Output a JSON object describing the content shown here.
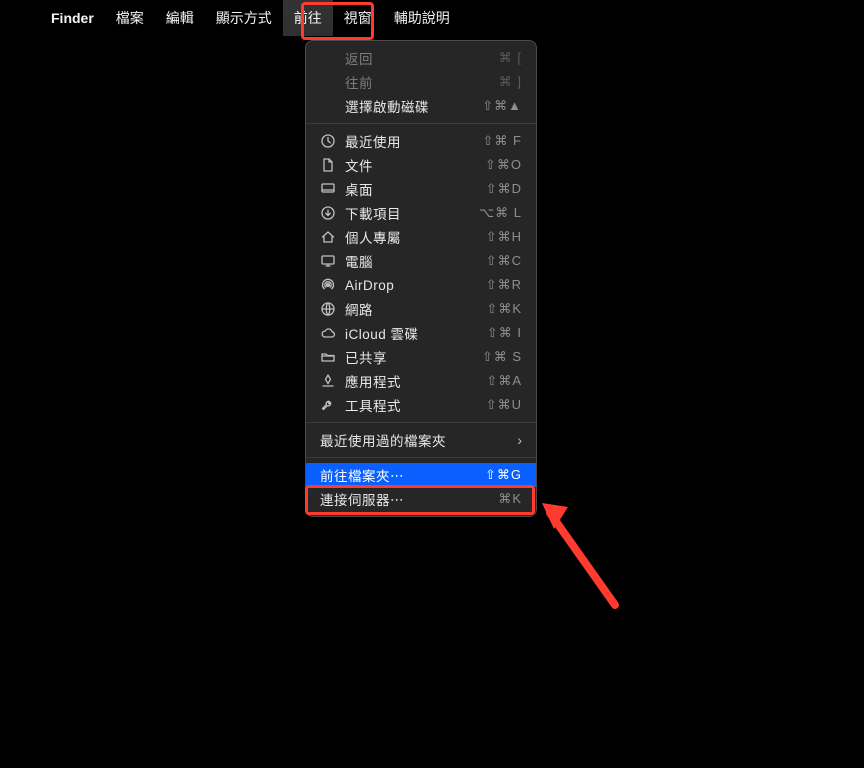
{
  "menubar": {
    "app": "Finder",
    "items": [
      "檔案",
      "編輯",
      "顯示方式",
      "前往",
      "視窗",
      "輔助說明"
    ],
    "open_index": 3
  },
  "dropdown": {
    "groups": [
      [
        {
          "id": "back",
          "label": "返回",
          "shortcut": "⌘ [",
          "disabled": true
        },
        {
          "id": "forward",
          "label": "往前",
          "shortcut": "⌘ ]",
          "disabled": true
        },
        {
          "id": "startup",
          "label": "選擇啟動磁碟",
          "shortcut": "⇧⌘▲"
        }
      ],
      [
        {
          "id": "recents",
          "icon": "clock-icon",
          "label": "最近使用",
          "shortcut": "⇧⌘ F"
        },
        {
          "id": "documents",
          "icon": "document-icon",
          "label": "文件",
          "shortcut": "⇧⌘O"
        },
        {
          "id": "desktop",
          "icon": "desktop-icon",
          "label": "桌面",
          "shortcut": "⇧⌘D"
        },
        {
          "id": "downloads",
          "icon": "download-icon",
          "label": "下載項目",
          "shortcut": "⌥⌘ L"
        },
        {
          "id": "home",
          "icon": "home-icon",
          "label": "個人專屬",
          "shortcut": "⇧⌘H"
        },
        {
          "id": "computer",
          "icon": "computer-icon",
          "label": "電腦",
          "shortcut": "⇧⌘C"
        },
        {
          "id": "airdrop",
          "icon": "airdrop-icon",
          "label": "AirDrop",
          "shortcut": "⇧⌘R"
        },
        {
          "id": "network",
          "icon": "globe-icon",
          "label": "網路",
          "shortcut": "⇧⌘K"
        },
        {
          "id": "icloud",
          "icon": "cloud-icon",
          "label": "iCloud 雲碟",
          "shortcut": "⇧⌘ I"
        },
        {
          "id": "shared",
          "icon": "folder-icon",
          "label": "已共享",
          "shortcut": "⇧⌘ S"
        },
        {
          "id": "apps",
          "icon": "apps-icon",
          "label": "應用程式",
          "shortcut": "⇧⌘A"
        },
        {
          "id": "utilities",
          "icon": "wrench-icon",
          "label": "工具程式",
          "shortcut": "⇧⌘U"
        }
      ],
      [
        {
          "id": "recent-folders",
          "label": "最近使用過的檔案夾",
          "submenu": true
        }
      ],
      [
        {
          "id": "goto-folder",
          "label": "前往檔案夾⋯",
          "shortcut": "⇧⌘G",
          "selected": true
        },
        {
          "id": "connect-server",
          "label": "連接伺服器⋯",
          "shortcut": "⌘K"
        }
      ]
    ]
  }
}
